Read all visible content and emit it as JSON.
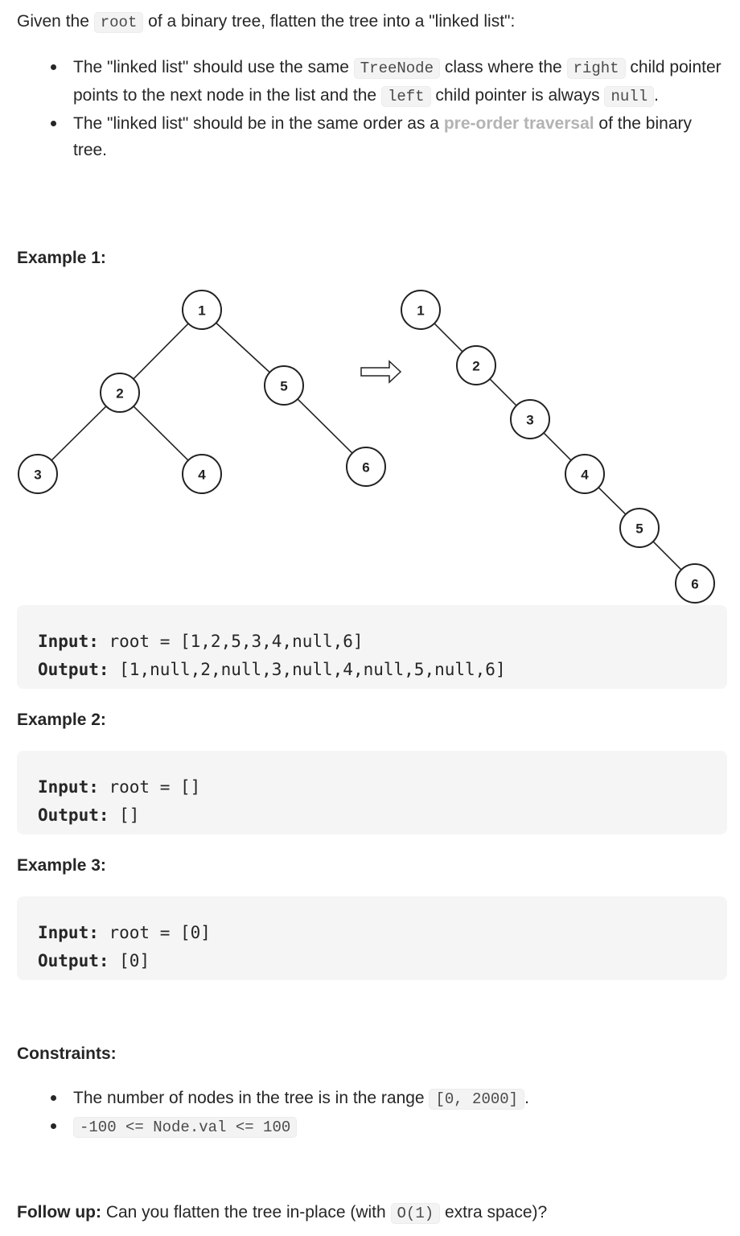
{
  "intro": {
    "before": "Given the ",
    "code": "root",
    "after": " of a binary tree, flatten the tree into a \"linked list\":"
  },
  "requirements": [
    {
      "t1": "The \"linked list\" should use the same ",
      "c1": "TreeNode",
      "t2": " class where the ",
      "c2": "right",
      "t3": " child pointer points to the next node in the list and the ",
      "c3": "left",
      "t4": " child pointer is always ",
      "c4": "null",
      "t5": "."
    },
    {
      "t1": "The \"linked list\" should be in the same order as a ",
      "link": "pre-order traversal",
      "t2": " of the binary tree."
    }
  ],
  "examples": [
    {
      "title": "Example 1:",
      "input_label": "Input:",
      "input": " root = [1,2,5,3,4,null,6]",
      "output_label": "Output:",
      "output": " [1,null,2,null,3,null,4,null,5,null,6]",
      "diagram": {
        "before_tree": {
          "nodes": [
            "1",
            "2",
            "5",
            "3",
            "4",
            "6"
          ],
          "edges": [
            [
              "1",
              "2"
            ],
            [
              "1",
              "5"
            ],
            [
              "2",
              "3"
            ],
            [
              "2",
              "4"
            ],
            [
              "5",
              "6"
            ]
          ]
        },
        "arrow": "right-arrow-icon",
        "after_list": [
          "1",
          "2",
          "3",
          "4",
          "5",
          "6"
        ]
      }
    },
    {
      "title": "Example 2:",
      "input_label": "Input:",
      "input": " root = []",
      "output_label": "Output:",
      "output": " []"
    },
    {
      "title": "Example 3:",
      "input_label": "Input:",
      "input": " root = [0]",
      "output_label": "Output:",
      "output": " [0]"
    }
  ],
  "constraints": {
    "title": "Constraints:",
    "items": [
      {
        "text": "The number of nodes in the tree is in the range ",
        "code": "[0, 2000]",
        "after": "."
      },
      {
        "text": "",
        "code": "-100 <= Node.val <= 100",
        "after": ""
      }
    ]
  },
  "follow_up": {
    "label": "Follow up:",
    "before": " Can you flatten the tree in-place (with ",
    "code": "O(1)",
    "after": " extra space)?"
  }
}
